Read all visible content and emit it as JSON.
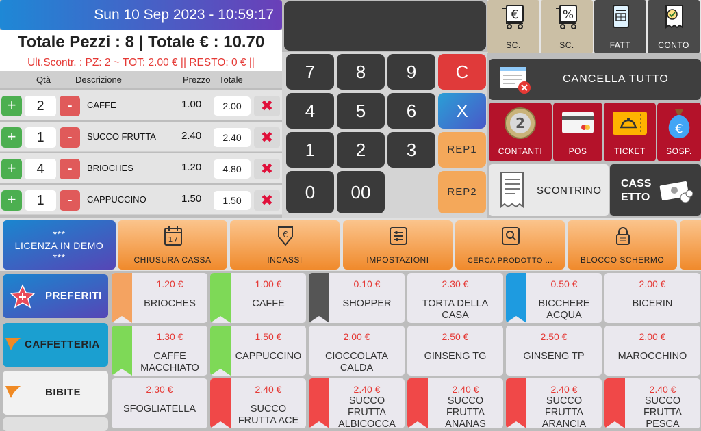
{
  "header": {
    "datetime": "Sun 10 Sep 2023 - 10:59:17",
    "summary": "Totale Pezzi : 8 | Totale € : 10.70",
    "last_receipt": "Ult.Scontr. :  PZ: 2 ~ TOT: 2.00 €  || RESTO: 0 € ||"
  },
  "order_columns": {
    "qty": "Qtà",
    "desc": "Descrizione",
    "price": "Prezzo",
    "total": "Totale"
  },
  "order_rows": [
    {
      "plus": "+",
      "qty": "2",
      "minus": "-",
      "desc": "CAFFE",
      "price": "1.00",
      "total": "2.00",
      "del": "✖"
    },
    {
      "plus": "+",
      "qty": "1",
      "minus": "-",
      "desc": "SUCCO FRUTTA",
      "price": "2.40",
      "total": "2.40",
      "del": "✖"
    },
    {
      "plus": "+",
      "qty": "4",
      "minus": "-",
      "desc": "BRIOCHES",
      "price": "1.20",
      "total": "4.80",
      "del": "✖"
    },
    {
      "plus": "+",
      "qty": "1",
      "minus": "-",
      "desc": "CAPPUCCINO",
      "price": "1.50",
      "total": "1.50",
      "del": "✖"
    }
  ],
  "keypad": {
    "k7": "7",
    "k8": "8",
    "k9": "9",
    "kC": "C",
    "k4": "4",
    "k5": "5",
    "k6": "6",
    "kX": "X",
    "k1": "1",
    "k2": "2",
    "k3": "3",
    "rep1": "REP1",
    "k0": "0",
    "k00": "00",
    "rep2": "REP2"
  },
  "top_buttons": [
    {
      "label": "SC.",
      "icon": "euro-cart-icon"
    },
    {
      "label": "SC.",
      "icon": "percent-cart-icon"
    },
    {
      "label": "FATT",
      "icon": "invoice-icon"
    },
    {
      "label": "CONTO",
      "icon": "receipt-check-icon"
    }
  ],
  "cancel_all": "CANCELLA TUTTO",
  "payments": [
    {
      "label": "CONTANTI",
      "icon": "euro-coin-icon"
    },
    {
      "label": "POS",
      "icon": "credit-card-icon"
    },
    {
      "label": "TICKET",
      "icon": "meal-ticket-icon"
    },
    {
      "label": "SOSP.",
      "icon": "money-bag-icon"
    }
  ],
  "scontrino": "SCONTRINO",
  "cassetto": {
    "line1": "CASS",
    "line2": "ETTO"
  },
  "licenza": {
    "stars1": "***",
    "text": "LICENZA IN DEMO",
    "stars2": "***"
  },
  "function_buttons": [
    {
      "label": "CHIUSURA CASSA",
      "icon": "calendar-icon"
    },
    {
      "label": "INCASSI",
      "icon": "euro-down-icon"
    },
    {
      "label": "IMPOSTAZIONI",
      "icon": "settings-sliders-icon"
    },
    {
      "label": "CERCA PRODOTTO ...",
      "icon": "search-icon"
    },
    {
      "label": "BLOCCO SCHERMO",
      "icon": "lock-icon"
    }
  ],
  "categories": [
    {
      "label": "PREFERITI",
      "icon": "star-icon"
    },
    {
      "label": "CAFFETTERIA",
      "icon": "tag-icon"
    },
    {
      "label": "BIBITE",
      "icon": "tag-icon"
    }
  ],
  "products": [
    {
      "price": "1.20 €",
      "name": "BRIOCHES",
      "tag": "#f4a361"
    },
    {
      "price": "1.00 €",
      "name": "CAFFE",
      "tag": "#7ed957"
    },
    {
      "price": "0.10 €",
      "name": "SHOPPER",
      "tag": "#555555"
    },
    {
      "price": "2.30 €",
      "name": "TORTA DELLA CASA",
      "tag": ""
    },
    {
      "price": "0.50 €",
      "name": "BICCHERE ACQUA",
      "tag": "#1e9be0"
    },
    {
      "price": "2.00 €",
      "name": "BICERIN",
      "tag": ""
    },
    {
      "price": "1.30 €",
      "name": "CAFFE MACCHIATO",
      "tag": "#7ed957"
    },
    {
      "price": "1.50 €",
      "name": "CAPPUCCINO",
      "tag": "#7ed957"
    },
    {
      "price": "2.00 €",
      "name": "CIOCCOLATA CALDA",
      "tag": ""
    },
    {
      "price": "2.50 €",
      "name": "GINSENG TG",
      "tag": ""
    },
    {
      "price": "2.50 €",
      "name": "GINSENG TP",
      "tag": ""
    },
    {
      "price": "2.00 €",
      "name": "MAROCCHINO",
      "tag": ""
    },
    {
      "price": "2.30 €",
      "name": "SFOGLIATELLA",
      "tag": ""
    },
    {
      "price": "2.40 €",
      "name": "SUCCO FRUTTA ACE",
      "tag": "#f04848"
    },
    {
      "price": "2.40 €",
      "name": "SUCCO FRUTTA ALBICOCCA",
      "tag": "#f04848"
    },
    {
      "price": "2.40 €",
      "name": "SUCCO FRUTTA ANANAS",
      "tag": "#f04848"
    },
    {
      "price": "2.40 €",
      "name": "SUCCO FRUTTA ARANCIA",
      "tag": "#f04848"
    },
    {
      "price": "2.40 €",
      "name": "SUCCO FRUTTA PESCA",
      "tag": "#f04848"
    }
  ]
}
